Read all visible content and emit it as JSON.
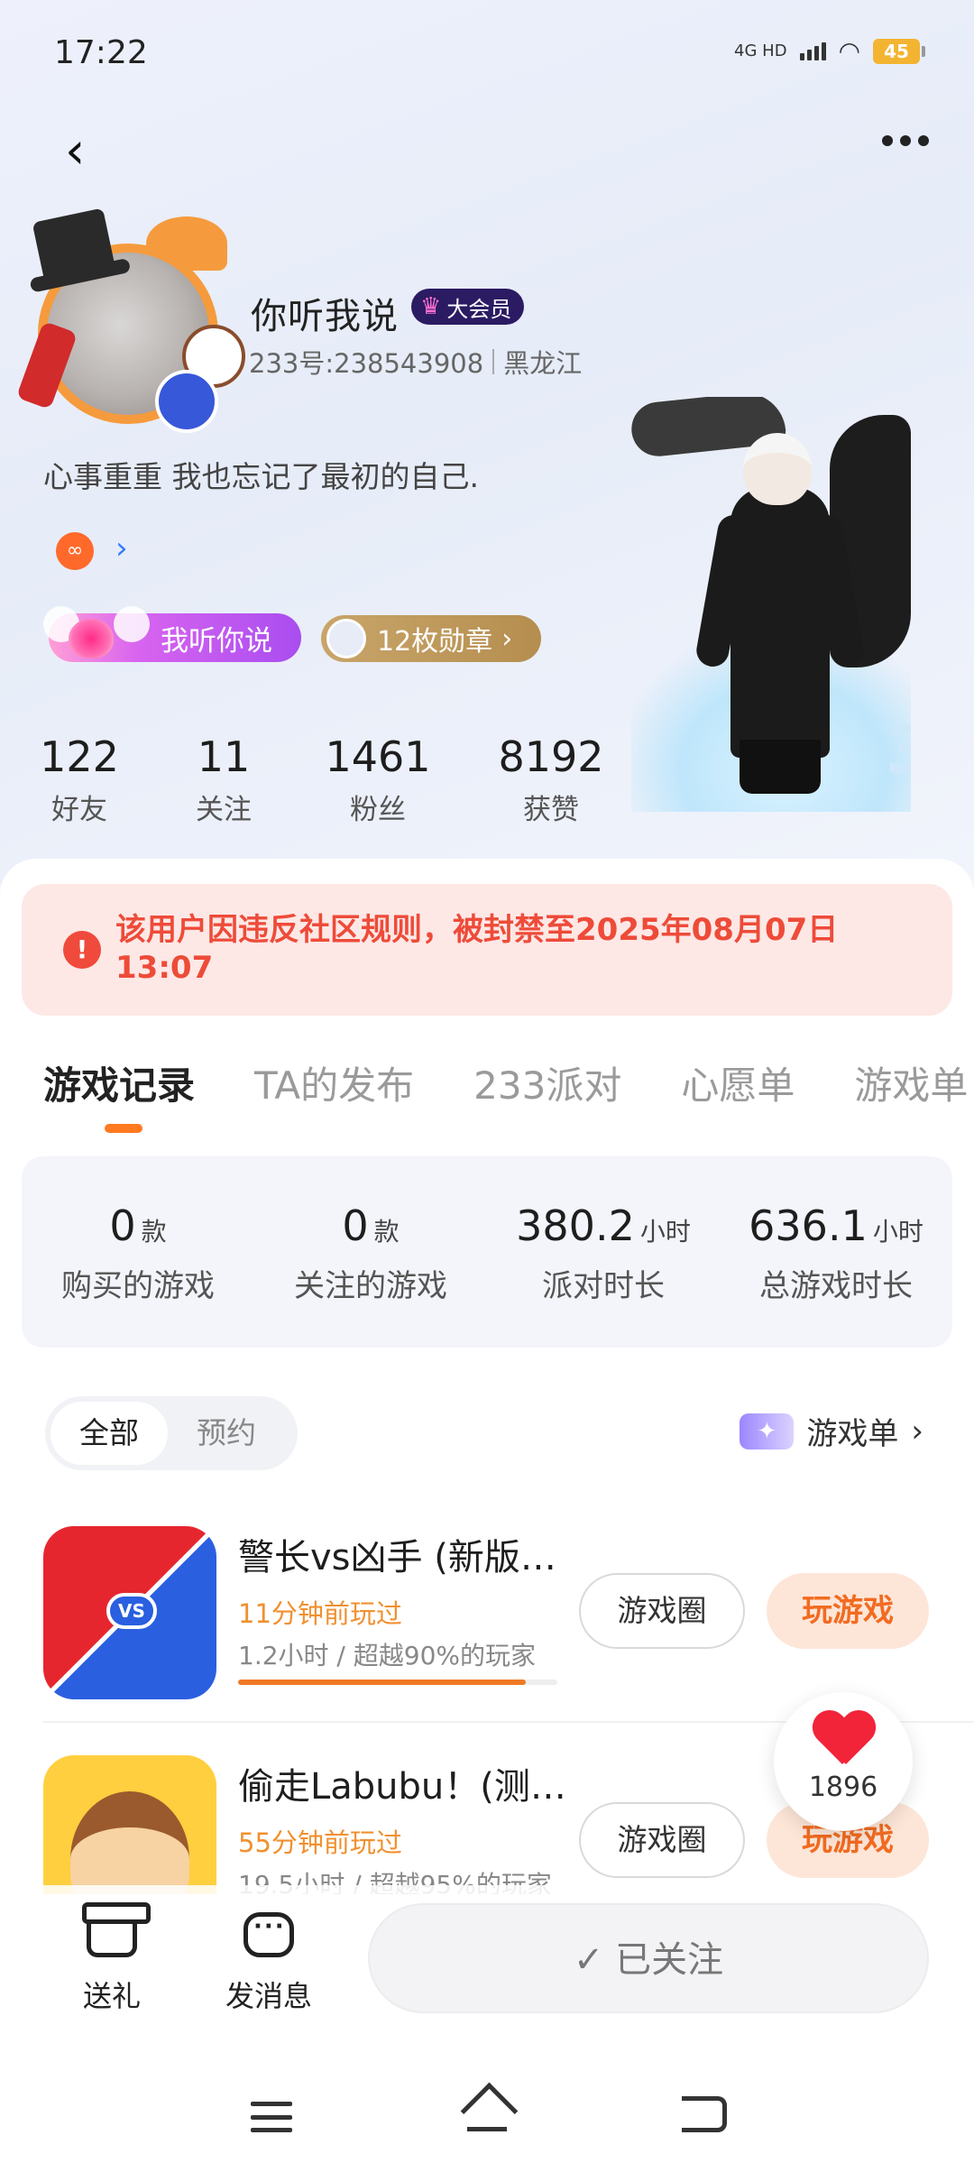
{
  "status_bar": {
    "time": "17:22",
    "network": "4G HD",
    "battery": "45"
  },
  "profile": {
    "name": "你听我说",
    "vip_label": "大会员",
    "id_text": "233号:238543908",
    "region": "黑龙江",
    "bio": "心事重重 我也忘记了最初的自己.",
    "title_badge": "我听你说",
    "medals_label": "12枚勋章",
    "stats": [
      {
        "value": "122",
        "label": "好友"
      },
      {
        "value": "11",
        "label": "关注"
      },
      {
        "value": "1461",
        "label": "粉丝"
      },
      {
        "value": "8192",
        "label": "获赞"
      }
    ]
  },
  "ban_notice": "该用户因违反社区规则，被封禁至2025年08月07日 13:07",
  "tabs": [
    {
      "label": "游戏记录",
      "active": true
    },
    {
      "label": "TA的发布"
    },
    {
      "label": "233派对"
    },
    {
      "label": "心愿单"
    },
    {
      "label": "游戏单"
    }
  ],
  "summary": [
    {
      "value": "0",
      "unit": "款",
      "label": "购买的游戏"
    },
    {
      "value": "0",
      "unit": "款",
      "label": "关注的游戏"
    },
    {
      "value": "380.2",
      "unit": "小时",
      "label": "派对时长"
    },
    {
      "value": "636.1",
      "unit": "小时",
      "label": "总游戏时长"
    }
  ],
  "filter": {
    "all": "全部",
    "reserve": "预约",
    "gamelist": "游戏单"
  },
  "games": [
    {
      "title": "警长vs凶手 (新版…",
      "last_played": "11分钟前玩过",
      "stats": "1.2小时 / 超越90%的玩家",
      "progress": 0.9,
      "circle_btn": "游戏圈",
      "play_btn": "玩游戏"
    },
    {
      "title": "偷走Labubu！(测…",
      "last_played": "55分钟前玩过",
      "stats": "19.5小时 / 超越95%的玩家",
      "progress": 0.95,
      "circle_btn": "游戏圈",
      "play_btn": "玩游戏"
    }
  ],
  "like_count": "1896",
  "bottom": {
    "gift": "送礼",
    "message": "发消息",
    "follow": "✓ 已关注"
  },
  "colors": {
    "accent": "#f26b21",
    "ban_text": "#ee4b39",
    "vip_bg": "#2b1b63"
  }
}
